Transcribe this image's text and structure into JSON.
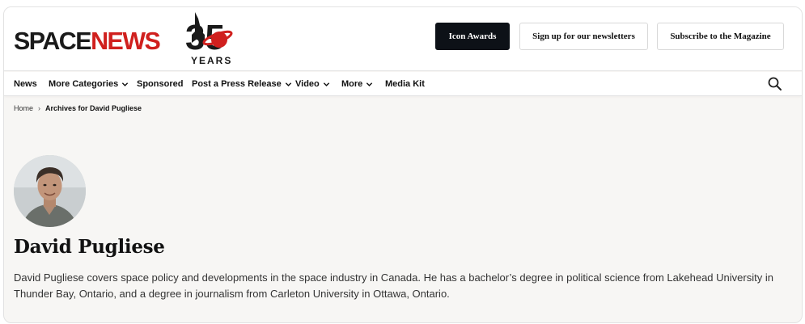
{
  "brand": {
    "name_dark": "SPACE",
    "name_red": "NEWS",
    "badge_number": "35",
    "badge_word": "YEARS",
    "colors": {
      "accent": "#d0201e",
      "dark": "#1a1a1a"
    }
  },
  "header": {
    "buttons": [
      {
        "label": "Icon Awards",
        "style": "dark"
      },
      {
        "label": "Sign up for our newsletters",
        "style": "light"
      },
      {
        "label": "Subscribe to the Magazine",
        "style": "light"
      }
    ]
  },
  "nav": {
    "items": [
      {
        "label": "News",
        "has_dropdown": false
      },
      {
        "label": "More Categories",
        "has_dropdown": true
      },
      {
        "label": "Sponsored",
        "has_dropdown": false
      },
      {
        "label": "Post a Press Release",
        "has_dropdown": true
      },
      {
        "label": "Video",
        "has_dropdown": true
      },
      {
        "label": "More",
        "has_dropdown": true
      },
      {
        "label": "Media Kit",
        "has_dropdown": false
      }
    ],
    "search_icon": "search-icon"
  },
  "breadcrumb": {
    "home": "Home",
    "current": "Archives for David Pugliese"
  },
  "author": {
    "name": "David Pugliese",
    "bio": "David Pugliese covers space policy and developments in the space industry in Canada. He has a bachelor’s degree in political science from Lakehead University in Thunder Bay, Ontario, and a degree in journalism from Carleton University in Ottawa, Ontario."
  }
}
